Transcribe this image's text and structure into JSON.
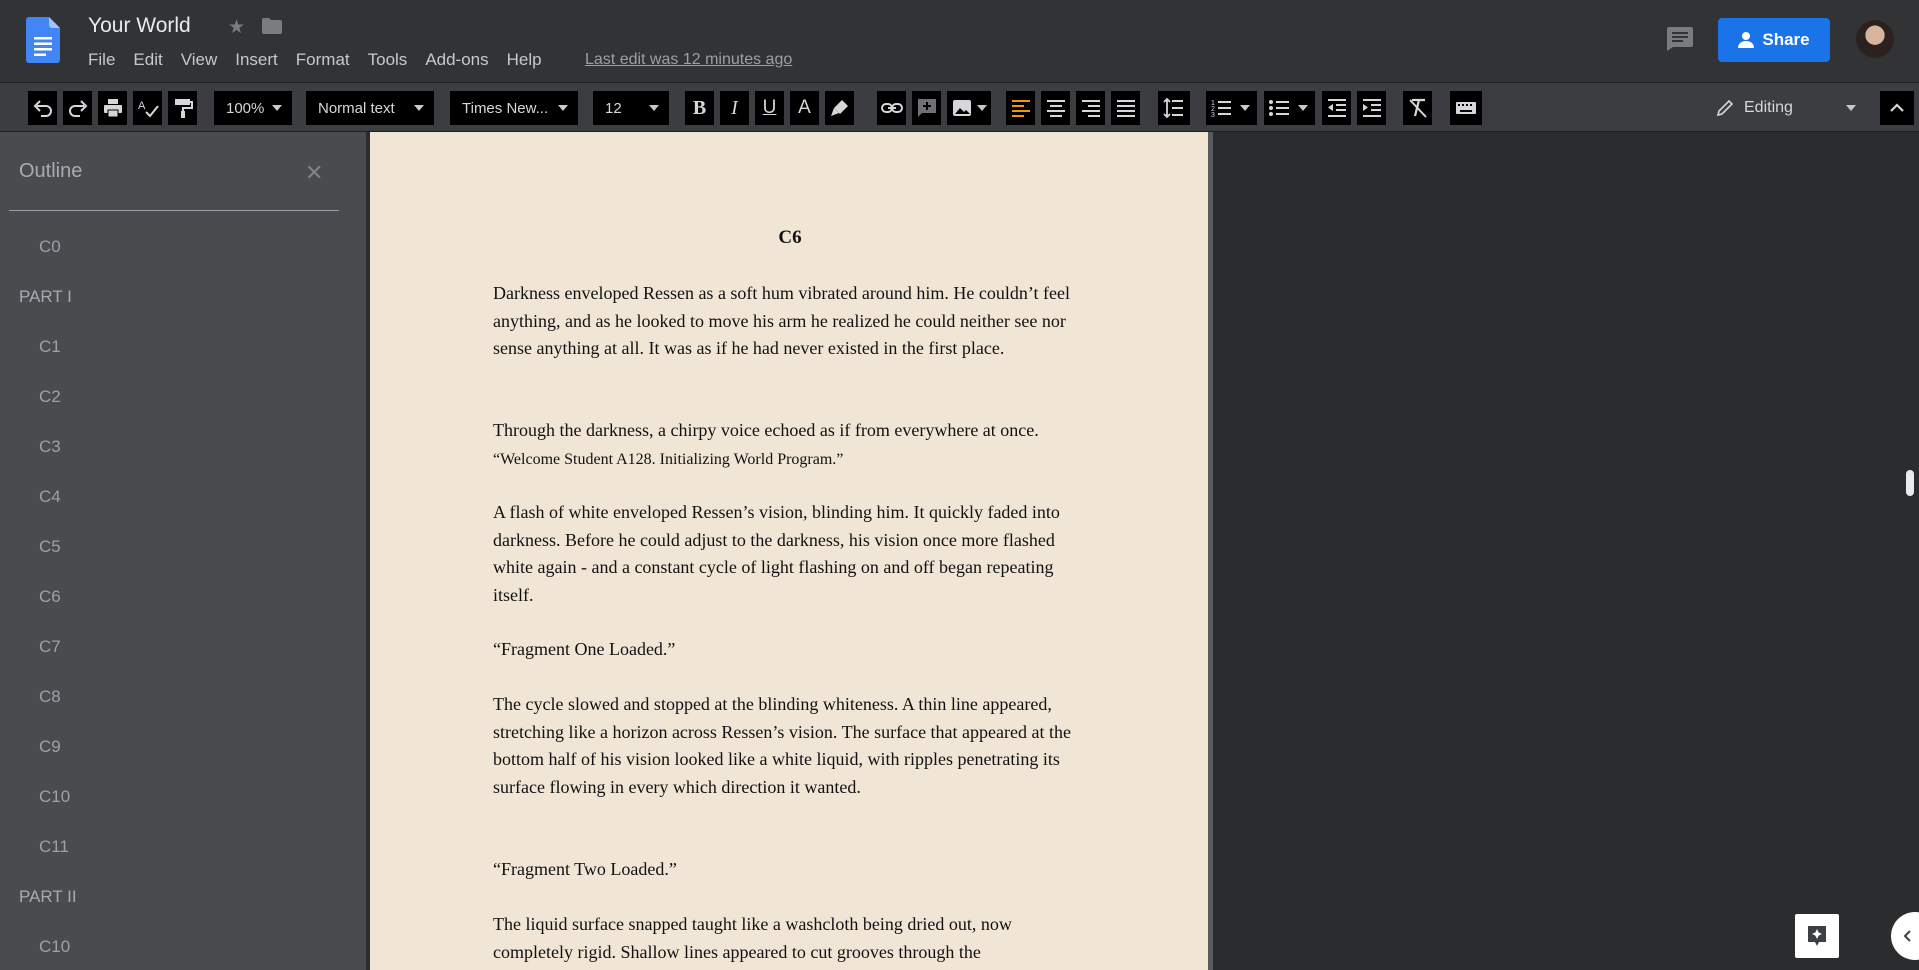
{
  "doc": {
    "title": "Your World",
    "last_edit": "Last edit was 12 minutes ago",
    "share_label": "Share"
  },
  "menu": [
    "File",
    "Edit",
    "View",
    "Insert",
    "Format",
    "Tools",
    "Add-ons",
    "Help"
  ],
  "toolbar": {
    "zoom": "100%",
    "style": "Normal text",
    "font": "Times New...",
    "size": "12",
    "mode": "Editing",
    "accent": "#f29900"
  },
  "outline": {
    "title": "Outline",
    "items": [
      {
        "label": "C0",
        "kind": "ch"
      },
      {
        "label": "PART I",
        "kind": "part"
      },
      {
        "label": "C1",
        "kind": "ch"
      },
      {
        "label": "C2",
        "kind": "ch"
      },
      {
        "label": "C3",
        "kind": "ch"
      },
      {
        "label": "C4",
        "kind": "ch"
      },
      {
        "label": "C5",
        "kind": "ch"
      },
      {
        "label": "C6",
        "kind": "ch"
      },
      {
        "label": "C7",
        "kind": "ch"
      },
      {
        "label": "C8",
        "kind": "ch"
      },
      {
        "label": "C9",
        "kind": "ch"
      },
      {
        "label": "C10",
        "kind": "ch"
      },
      {
        "label": "C11",
        "kind": "ch"
      },
      {
        "label": "PART II",
        "kind": "part"
      },
      {
        "label": "C10",
        "kind": "ch"
      }
    ]
  },
  "page": {
    "heading": "C6",
    "paragraphs": [
      "Darkness enveloped Ressen as a soft hum vibrated around him. He couldn’t feel anything, and as he looked to move his arm he realized he could neither see nor sense anything at all. It was as if he had never existed in the first place.",
      "Through the darkness, a chirpy voice echoed as if from everywhere at once.",
      "“Welcome Student A128. Initializing World Program.”",
      "A flash of white enveloped Ressen’s vision, blinding him. It quickly faded into darkness. Before he could adjust to the darkness, his vision once more flashed white again - and a constant cycle of light flashing on and off began repeating itself.",
      "“Fragment One Loaded.”",
      "The cycle slowed and stopped at the blinding whiteness. A thin line appeared, stretching like a horizon across Ressen’s vision. The surface that appeared at the bottom half of his vision looked like a white liquid, with ripples penetrating its surface flowing in every which direction it wanted.",
      "“Fragment Two Loaded.”",
      "The liquid surface snapped taught like a washcloth being dried out, now completely rigid. Shallow lines appeared to cut grooves through the"
    ]
  }
}
